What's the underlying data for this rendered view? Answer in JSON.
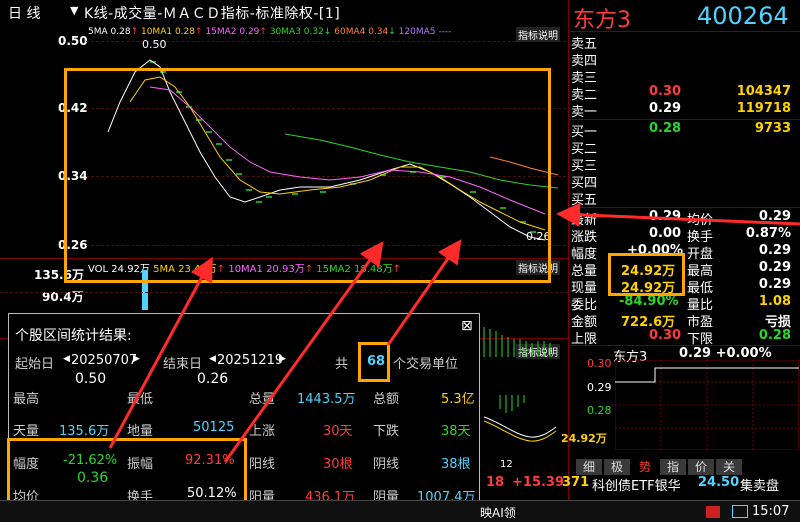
{
  "header": {
    "period_label": "日 线",
    "chart_title": "K线-成交量-ＭＡＣＤ指标-标准除权-[1]",
    "stock_name": "东方3",
    "stock_code": "400264"
  },
  "price_chart": {
    "ma_legend": {
      "ma5": "5MA 0.28",
      "ma10": "10MA1 0.28",
      "ma15": "15MA2 0.29",
      "ma30": "30MA3 0.32",
      "ma60": "60MA4 0.34",
      "ma120": "120MA5 ----"
    },
    "indicator_link": "指标说明",
    "y_ticks": [
      "0.50",
      "0.42",
      "0.34",
      "0.26"
    ],
    "high_mark": "0.50",
    "low_mark": "0.26"
  },
  "volume_chart": {
    "legend": {
      "vol": "VOL 24.92万",
      "ma5": "5MA 23.42万",
      "ma10": "10MA1 20.93万",
      "ma15": "15MA2 18.48万"
    },
    "indicator_link": "指标说明",
    "y_ticks": [
      "135.6万",
      "90.4万"
    ]
  },
  "macd_chart": {
    "indicator_link": "指标说明",
    "x_tick": "12"
  },
  "order_book": {
    "sell": [
      {
        "label": "卖五",
        "price": "",
        "vol": ""
      },
      {
        "label": "卖四",
        "price": "",
        "vol": ""
      },
      {
        "label": "卖三",
        "price": "",
        "vol": ""
      },
      {
        "label": "卖二",
        "price": "0.30",
        "vol": "104347"
      },
      {
        "label": "卖一",
        "price": "0.29",
        "vol": "119718"
      }
    ],
    "buy": [
      {
        "label": "买一",
        "price": "0.28",
        "vol": "9733"
      },
      {
        "label": "买二",
        "price": "",
        "vol": ""
      },
      {
        "label": "买三",
        "price": "",
        "vol": ""
      },
      {
        "label": "买四",
        "price": "",
        "vol": ""
      },
      {
        "label": "买五",
        "price": "",
        "vol": ""
      }
    ]
  },
  "quote": [
    {
      "l1": "最新",
      "v1": "0.29",
      "l2": "均价",
      "v2": "0.29"
    },
    {
      "l1": "涨跌",
      "v1": "0.00",
      "l2": "换手",
      "v2": "0.87%"
    },
    {
      "l1": "幅度",
      "v1": "+0.00%",
      "l2": "开盘",
      "v2": "0.29"
    },
    {
      "l1": "总量",
      "v1": "24.92万",
      "l2": "最高",
      "v2": "0.29"
    },
    {
      "l1": "现量",
      "v1": "24.92万",
      "l2": "最低",
      "v2": "0.29"
    },
    {
      "l1": "委比",
      "v1": "-84.90%",
      "l2": "量比",
      "v2": "1.08"
    },
    {
      "l1": "金额",
      "v1": "722.6万",
      "l2": "市盈",
      "v2": "亏损"
    },
    {
      "l1": "上限",
      "v1": "0.30",
      "l2": "下限",
      "v2": "0.28"
    }
  ],
  "mini_chart": {
    "name": "东方3",
    "price_change": "0.29 +0.00%",
    "y_top": "0.30",
    "y_mid": "0.29",
    "y_bot": "0.28",
    "volume": "24.92万"
  },
  "bottom_tabs": [
    "细",
    "极",
    "势",
    "指",
    "价",
    "关"
  ],
  "stat_panel": {
    "title": "个股区间统计结果:",
    "close_icon": "⊠",
    "start_label": "起始日",
    "start_date": "20250707",
    "start_price": "0.50",
    "end_label": "结束日",
    "end_date": "20251219",
    "end_price": "0.26",
    "total_prefix": "共",
    "total_days": "68",
    "total_suffix": "个交易单位",
    "r1": {
      "a_l": "最高",
      "b_l": "最低",
      "c_l": "总量",
      "c_v": "1443.5万",
      "d_l": "总额",
      "d_v": "5.3亿"
    },
    "r2": {
      "a_l": "天量",
      "a_v": "135.6万",
      "b_l": "地量",
      "b_v": "50125",
      "c_l": "上涨",
      "c_v": "30天",
      "d_l": "下跌",
      "d_v": "38天"
    },
    "r3": {
      "a_l": "幅度",
      "a_v": "-21.62%",
      "b_l": "振幅",
      "b_v": "92.31%",
      "c_l": "阳线",
      "c_v": "30根",
      "d_l": "阴线",
      "d_v": "38根"
    },
    "r3_extra": "0.36",
    "r4": {
      "a_l": "均价",
      "b_l": "换手",
      "b_v": "50.12%",
      "c_l": "阳量",
      "c_v": "436.1万",
      "d_l": "阴量",
      "d_v": "1007.4万"
    }
  },
  "status_bar": {
    "value1": "18",
    "value2": "+15.39",
    "value3": "371",
    "ticker_text": "科创债ETF银华",
    "ticker_value": "24.50",
    "ticker_suffix": "集卖盘",
    "ai_label": "映AI领",
    "time": "15:07"
  }
}
